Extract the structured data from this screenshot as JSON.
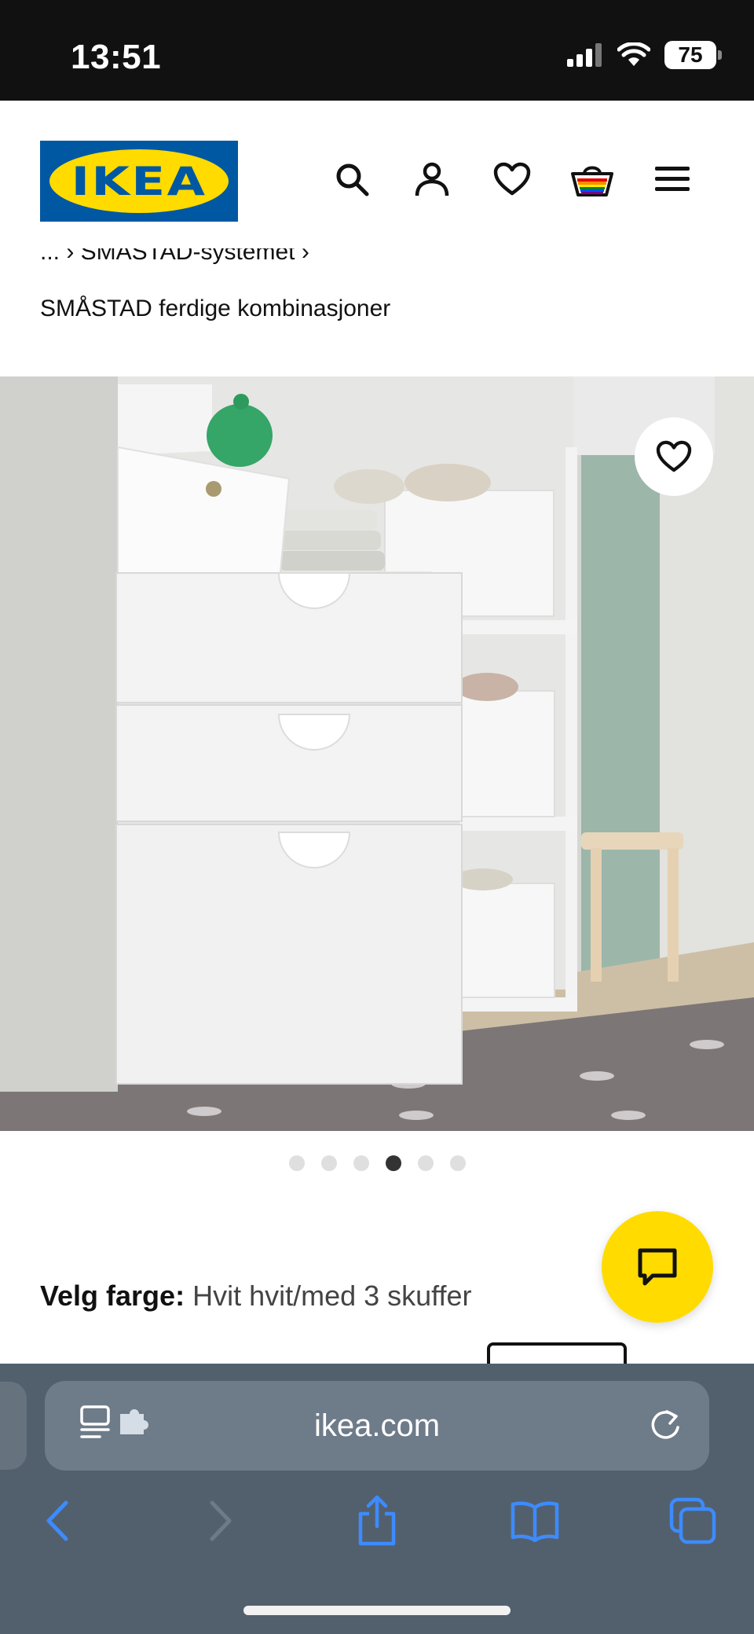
{
  "status_bar": {
    "time": "13:51",
    "battery": "75"
  },
  "header": {
    "logo_text": "IKEA",
    "icons": [
      "search-icon",
      "account-icon",
      "heart-icon",
      "basket-icon",
      "menu-icon"
    ]
  },
  "breadcrumb": {
    "top_line": "...  ›  SMÅSTAD-systemet  ›",
    "current": "SMÅSTAD ferdige kombinasjoner"
  },
  "carousel": {
    "total": 6,
    "active_index": 3
  },
  "color_selector": {
    "label": "Velg farge:",
    "value": "Hvit hvit/med 3 skuffer"
  },
  "browser": {
    "url": "ikea.com"
  },
  "colors": {
    "ikea_blue": "#0058a3",
    "ikea_yellow": "#ffdb00",
    "safari_bar": "#52606e",
    "ios_blue": "#3b82f6"
  }
}
